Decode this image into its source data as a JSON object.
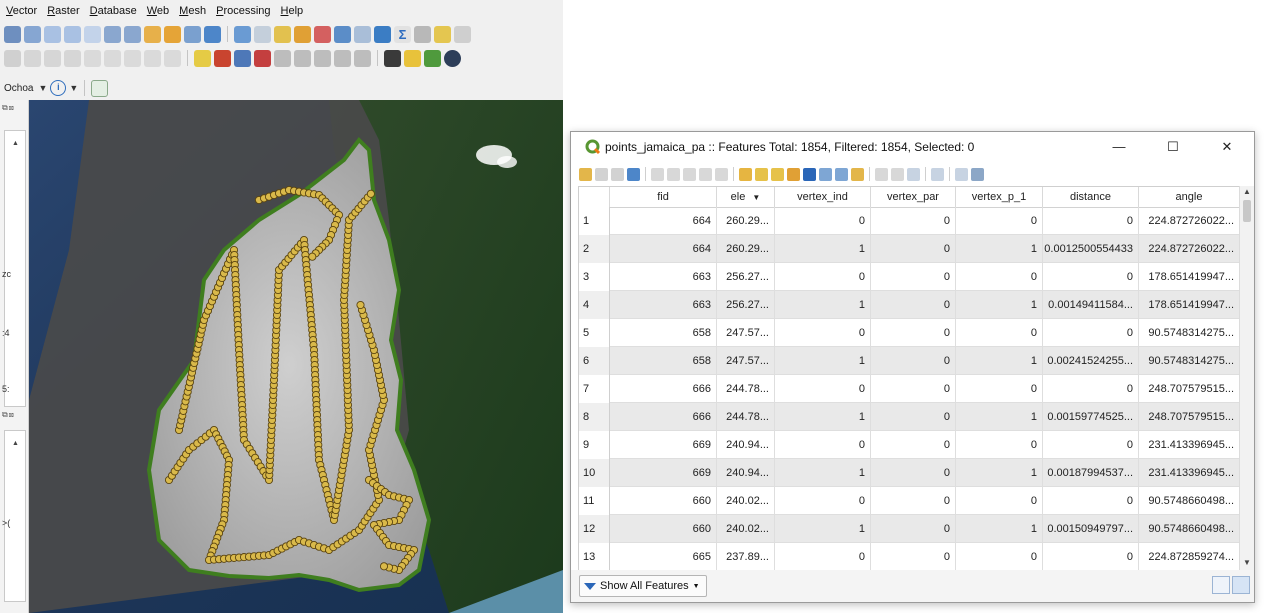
{
  "qgis": {
    "menu": [
      "Vector",
      "Raster",
      "Database",
      "Web",
      "Mesh",
      "Processing",
      "Help"
    ],
    "menu_underline_first": [
      true,
      true,
      true,
      true,
      true,
      true,
      true
    ],
    "crs_label": "Ochoa",
    "panel_edge_labels": [
      "zc",
      ":4",
      "5:",
      ">(",
      "○"
    ]
  },
  "attribute_table": {
    "window_title": "points_jamaica_pa :: Features Total: 1854, Filtered: 1854, Selected: 0",
    "window_buttons": [
      "—",
      "☐",
      "✕"
    ],
    "columns": [
      "fid",
      "ele",
      "vertex_ind",
      "vertex_par",
      "vertex_p_1",
      "distance",
      "angle"
    ],
    "sort_column": "ele",
    "rows": [
      {
        "n": "1",
        "fid": "664",
        "ele": "260.29...",
        "vertex_ind": "0",
        "vertex_par": "0",
        "vertex_p_1": "0",
        "distance": "0",
        "angle": "224.872726022..."
      },
      {
        "n": "2",
        "fid": "664",
        "ele": "260.29...",
        "vertex_ind": "1",
        "vertex_par": "0",
        "vertex_p_1": "1",
        "distance": "0.0012500554433",
        "angle": "224.872726022..."
      },
      {
        "n": "3",
        "fid": "663",
        "ele": "256.27...",
        "vertex_ind": "0",
        "vertex_par": "0",
        "vertex_p_1": "0",
        "distance": "0",
        "angle": "178.651419947..."
      },
      {
        "n": "4",
        "fid": "663",
        "ele": "256.27...",
        "vertex_ind": "1",
        "vertex_par": "0",
        "vertex_p_1": "1",
        "distance": "0.00149411584...",
        "angle": "178.651419947..."
      },
      {
        "n": "5",
        "fid": "658",
        "ele": "247.57...",
        "vertex_ind": "0",
        "vertex_par": "0",
        "vertex_p_1": "0",
        "distance": "0",
        "angle": "90.5748314275..."
      },
      {
        "n": "6",
        "fid": "658",
        "ele": "247.57...",
        "vertex_ind": "1",
        "vertex_par": "0",
        "vertex_p_1": "1",
        "distance": "0.00241524255...",
        "angle": "90.5748314275..."
      },
      {
        "n": "7",
        "fid": "666",
        "ele": "244.78...",
        "vertex_ind": "0",
        "vertex_par": "0",
        "vertex_p_1": "0",
        "distance": "0",
        "angle": "248.707579515..."
      },
      {
        "n": "8",
        "fid": "666",
        "ele": "244.78...",
        "vertex_ind": "1",
        "vertex_par": "0",
        "vertex_p_1": "1",
        "distance": "0.00159774525...",
        "angle": "248.707579515..."
      },
      {
        "n": "9",
        "fid": "669",
        "ele": "240.94...",
        "vertex_ind": "0",
        "vertex_par": "0",
        "vertex_p_1": "0",
        "distance": "0",
        "angle": "231.413396945..."
      },
      {
        "n": "10",
        "fid": "669",
        "ele": "240.94...",
        "vertex_ind": "1",
        "vertex_par": "0",
        "vertex_p_1": "1",
        "distance": "0.00187994537...",
        "angle": "231.413396945..."
      },
      {
        "n": "11",
        "fid": "660",
        "ele": "240.02...",
        "vertex_ind": "0",
        "vertex_par": "0",
        "vertex_p_1": "0",
        "distance": "0",
        "angle": "90.5748660498..."
      },
      {
        "n": "12",
        "fid": "660",
        "ele": "240.02...",
        "vertex_ind": "1",
        "vertex_par": "0",
        "vertex_p_1": "1",
        "distance": "0.00150949797...",
        "angle": "90.5748660498..."
      },
      {
        "n": "13",
        "fid": "665",
        "ele": "237.89...",
        "vertex_ind": "0",
        "vertex_par": "0",
        "vertex_p_1": "0",
        "distance": "0",
        "angle": "224.872859274..."
      }
    ],
    "filter_button": "Show All Features"
  },
  "colors": {
    "point_fill": "#d9b94a",
    "point_stroke": "#5a4410",
    "polygon_outline": "#3f7e1f",
    "header_accent": "#2f6ebd"
  }
}
